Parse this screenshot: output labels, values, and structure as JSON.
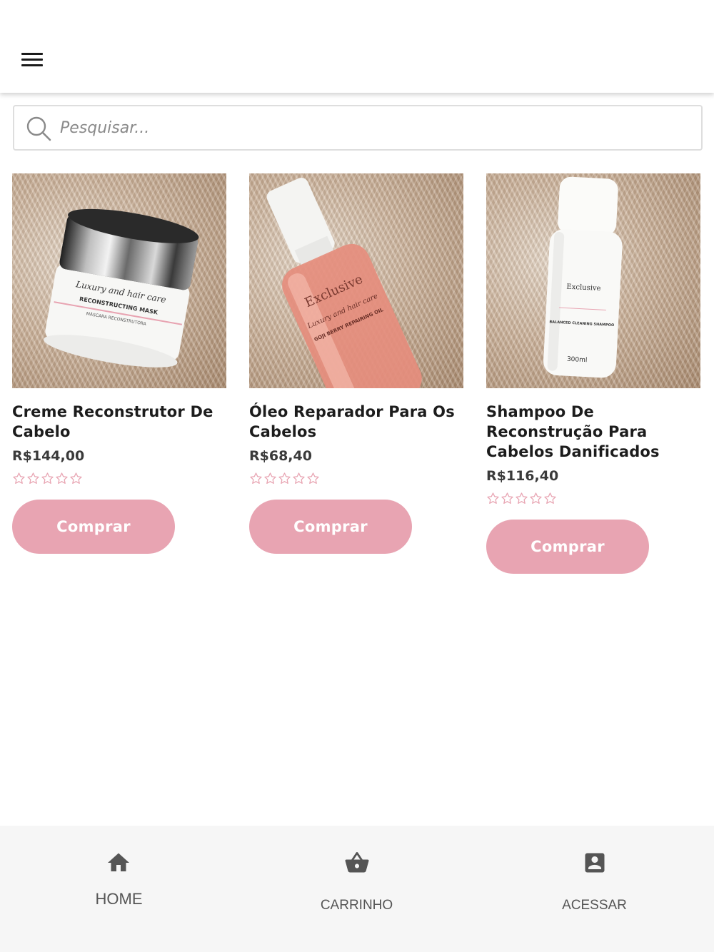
{
  "header": {
    "menu_icon": "hamburger-menu-icon"
  },
  "search": {
    "placeholder": "Pesquisar...",
    "value": "",
    "icon": "search-icon"
  },
  "products": [
    {
      "title": "Creme Reconstrutor De Cabelo",
      "price": "R$144,00",
      "rating": 0,
      "rating_max": 5,
      "button_label": "Comprar",
      "image_label_line1": "Luxury and hair care",
      "image_label_line2": "RECONSTRUCTING MASK",
      "image_label_line3": "MÁSCARA RECONSTRUTORA"
    },
    {
      "title": "Óleo Reparador Para Os Cabelos",
      "price": "R$68,40",
      "rating": 0,
      "rating_max": 5,
      "button_label": "Comprar",
      "image_label_line1": "Exclusive",
      "image_label_line2": "Luxury and hair care",
      "image_label_line3": "GOJI BERRY REPAIRING OIL"
    },
    {
      "title": "Shampoo De Reconstrução Para Cabelos Danificados",
      "price": "R$116,40",
      "rating": 0,
      "rating_max": 5,
      "button_label": "Comprar",
      "image_label_line1": "Exclusive",
      "image_label_line2": "BALANCED CLEANING SHAMPOO",
      "image_label_line3": "300ml"
    }
  ],
  "bottom_nav": [
    {
      "label": "HOME",
      "icon": "home-icon"
    },
    {
      "label": "CARRINHO",
      "icon": "basket-icon"
    },
    {
      "label": "ACESSAR",
      "icon": "account-box-icon"
    }
  ],
  "colors": {
    "button_bg": "#e8a4b2",
    "star_outline": "#e8a4b2",
    "nav_bg": "#f6f6f6",
    "nav_text": "#555555"
  }
}
